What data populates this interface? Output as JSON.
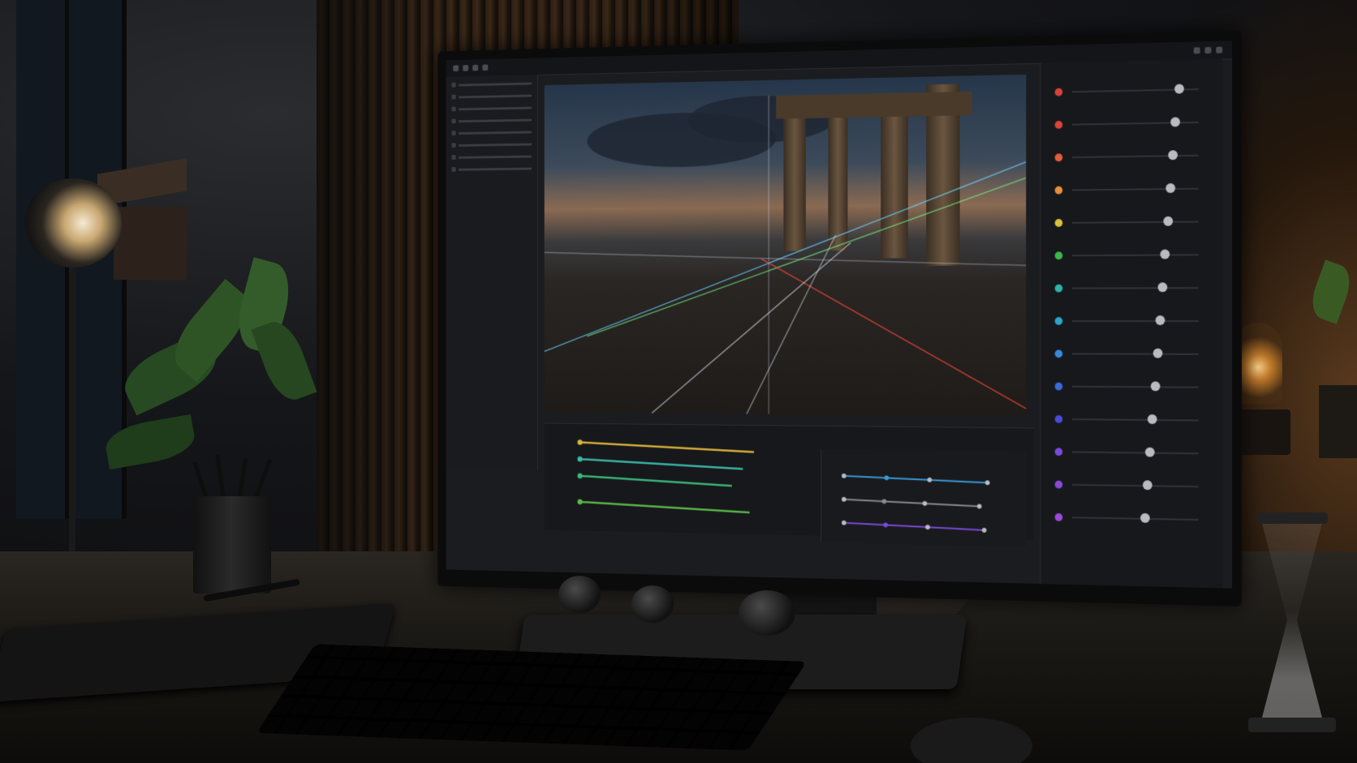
{
  "scene": {
    "viewer_image": "ancient-temple-ruins-landscape",
    "controls": {
      "parameter_rows": [
        {
          "color": "#d9413a",
          "value": 0.85
        },
        {
          "color": "#d9453a",
          "value": 0.82
        },
        {
          "color": "#e0603a",
          "value": 0.8
        },
        {
          "color": "#e6903a",
          "value": 0.78
        },
        {
          "color": "#d9c23a",
          "value": 0.76
        },
        {
          "color": "#3ab84a",
          "value": 0.74
        },
        {
          "color": "#2ab5a8",
          "value": 0.72
        },
        {
          "color": "#2aa6c8",
          "value": 0.7
        },
        {
          "color": "#3a86d9",
          "value": 0.68
        },
        {
          "color": "#3a6ad9",
          "value": 0.66
        },
        {
          "color": "#4a4ad9",
          "value": 0.64
        },
        {
          "color": "#7a4ad9",
          "value": 0.62
        },
        {
          "color": "#8a4ad9",
          "value": 0.6
        },
        {
          "color": "#9a4ad9",
          "value": 0.58
        }
      ],
      "timeline_tracks": [
        {
          "color": "#d9b13a",
          "value": 0.8
        },
        {
          "color": "#3ab8a8",
          "value": 0.75
        },
        {
          "color": "#3ab87a",
          "value": 0.7
        },
        {
          "color": "#5ab84a",
          "value": 0.78
        }
      ],
      "curve_tracks": [
        {
          "color": "#3a9ad9",
          "value": 0.9
        },
        {
          "color": "#8a8a8a",
          "value": 0.85
        },
        {
          "color": "#7a4ad9",
          "value": 0.88
        }
      ]
    }
  }
}
